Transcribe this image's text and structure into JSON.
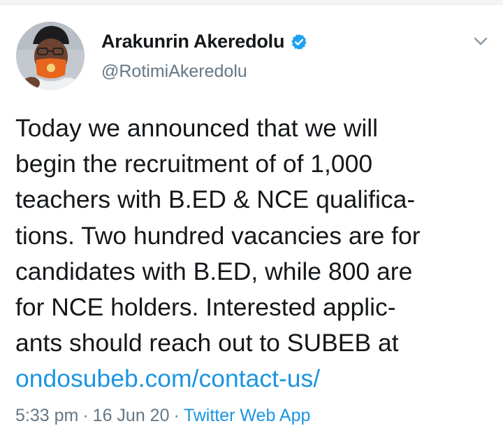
{
  "tweet": {
    "author": {
      "display_name": "Arakunrin Akeredolu",
      "handle": "@RotimiAkeredolu",
      "verified": true,
      "avatar_icon": "profile-photo"
    },
    "menu_icon": "chevron-down-icon",
    "text_lines": [
      "Today we announced that we will",
      "begin the recruitment of of 1,000",
      "teachers with B.ED & NCE qualifica-",
      "tions. Two hundred vacancies are for",
      "candidates with B.ED, while 800 are",
      "for NCE holders. Interested applic-",
      "ants should reach out to SUBEB at"
    ],
    "link": "ondosubeb.com/contact-us/",
    "time": "5:33 pm",
    "date": "16 Jun 20",
    "source": "Twitter Web App",
    "separator": "·"
  },
  "colors": {
    "link": "#1b95e0",
    "verified": "#1da1f2",
    "secondary_text": "#657786",
    "primary_text": "#14171a"
  }
}
